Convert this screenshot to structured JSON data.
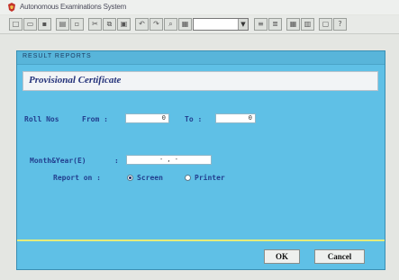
{
  "app": {
    "title": "Autonomous Examinations System"
  },
  "toolbar": {
    "combo_value": ""
  },
  "window": {
    "section_title": "RESULT REPORTS",
    "form_title": "Provisional Certificate",
    "roll_label": "Roll Nos",
    "from_label": "From :",
    "from_value": "0",
    "to_label": "To :",
    "to_value": "0",
    "monthyear_label": "Month&Year(E)",
    "colon": ":",
    "monthyear_value": "-    ,  -",
    "report_on_label": "Report on :",
    "option_screen": "Screen",
    "option_printer": "Printer",
    "selected_option": "Screen",
    "ok_label": "OK",
    "cancel_label": "Cancel"
  },
  "colors": {
    "window_bg": "#5fc0e6",
    "label_color": "#223e8e",
    "separator": "#e4ec7a"
  }
}
